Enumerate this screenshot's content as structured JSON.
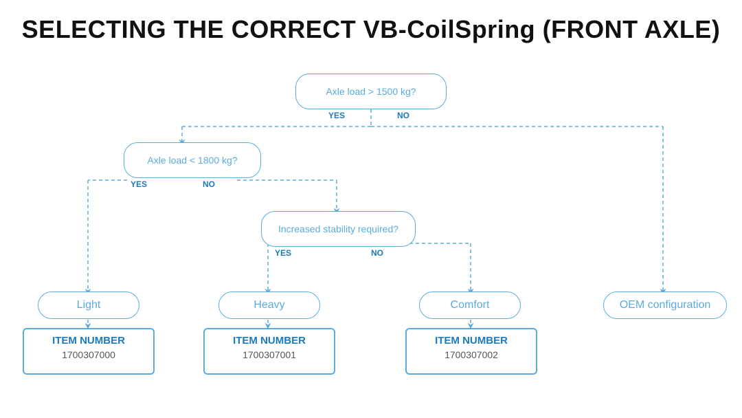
{
  "title": "SELECTING THE CORRECT VB-CoilSpring (FRONT AXLE)",
  "diagram": {
    "decision1": {
      "text": "Axle load > 1500 kg?",
      "yes": "YES",
      "no": "NO"
    },
    "decision2": {
      "text": "Axle load < 1800 kg?",
      "yes": "YES",
      "no": "NO"
    },
    "decision3": {
      "text": "Increased stability required?",
      "yes": "YES",
      "no": "NO"
    },
    "results": [
      {
        "id": "light",
        "label": "Light"
      },
      {
        "id": "heavy",
        "label": "Heavy"
      },
      {
        "id": "comfort",
        "label": "Comfort"
      },
      {
        "id": "oem",
        "label": "OEM configuration"
      }
    ],
    "items": [
      {
        "id": "item0",
        "label": "ITEM NUMBER",
        "number": "1700307000"
      },
      {
        "id": "item1",
        "label": "ITEM NUMBER",
        "number": "1700307001"
      },
      {
        "id": "item2",
        "label": "ITEM NUMBER",
        "number": "1700307002"
      }
    ]
  }
}
